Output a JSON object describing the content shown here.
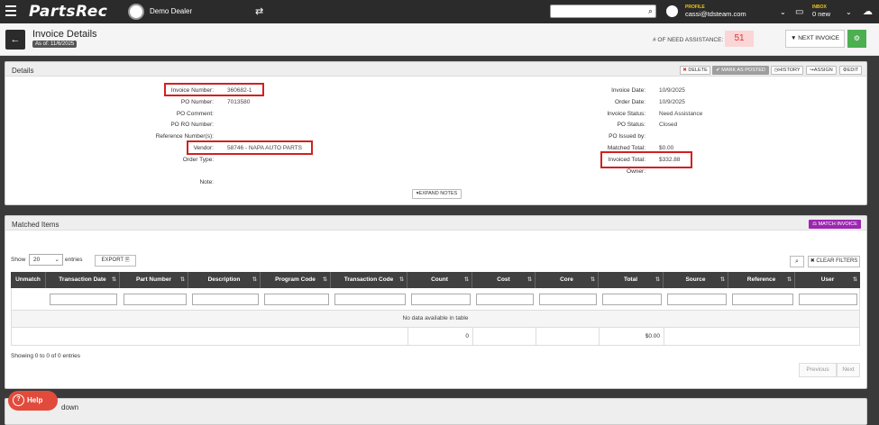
{
  "topbar": {
    "app_name": "PartsRec",
    "dealer_name": "Demo Dealer",
    "profile_label": "PROFILE",
    "profile_email": "cassi@tdsteam.com",
    "inbox_label": "INBOX",
    "inbox_count": "0 new"
  },
  "header": {
    "title": "Invoice Details",
    "as_of": "As of: 11/6/2025",
    "need_assistance_label": "# OF NEED ASSISTANCE:",
    "need_assistance_count": "51",
    "next_invoice_label": "NEXT INVOICE"
  },
  "details": {
    "panel_title": "Details",
    "actions": {
      "delete": "DELETE",
      "mark_as_posted": "MARK AS POSTED",
      "history": "HISTORY",
      "assign": "ASSIGN",
      "edit": "EDIT"
    },
    "left_fields": [
      {
        "label": "Invoice Number:",
        "value": "360682-1"
      },
      {
        "label": "PO Number:",
        "value": "7013580"
      },
      {
        "label": "PO Comment:",
        "value": ""
      },
      {
        "label": "PO RO Number:",
        "value": ""
      },
      {
        "label": "Reference Number(s):",
        "value": ""
      },
      {
        "label": "Vendor:",
        "value": "58746 - NAPA AUTO PARTS"
      },
      {
        "label": "Order Type:",
        "value": ""
      },
      {
        "label": "Note:",
        "value": ""
      }
    ],
    "right_fields": [
      {
        "label": "Invoice Date:",
        "value": "10/9/2025"
      },
      {
        "label": "Order Date:",
        "value": "10/9/2025"
      },
      {
        "label": "Invoice Status:",
        "value": "Need Assistance"
      },
      {
        "label": "PO Status:",
        "value": "Closed"
      },
      {
        "label": "PO Issued by:",
        "value": ""
      },
      {
        "label": "Matched Total:",
        "value": "$0.00"
      },
      {
        "label": "Invoiced Total:",
        "value": "$332.88"
      },
      {
        "label": "Owner:",
        "value": ""
      }
    ],
    "expand_notes": "EXPAND NOTES"
  },
  "matched": {
    "panel_title": "Matched Items",
    "match_invoice": "MATCH INVOICE",
    "show_label": "Show",
    "entries_value": "20",
    "entries_label": "entries",
    "export_label": "EXPORT",
    "clear_filters": "CLEAR FILTERS",
    "columns": [
      "Unmatch",
      "Transaction Date",
      "Part Number",
      "Description",
      "Program Code",
      "Transaction Code",
      "Count",
      "Cost",
      "Core",
      "Total",
      "Source",
      "Reference",
      "User"
    ],
    "no_data": "No data available in table",
    "totals": {
      "count": "0",
      "total": "$0.00"
    },
    "info": "Showing 0 to 0 of 0 entries",
    "previous": "Previous",
    "next": "Next"
  },
  "bottom_panel_title_fragment": "down",
  "help_label": "Help"
}
